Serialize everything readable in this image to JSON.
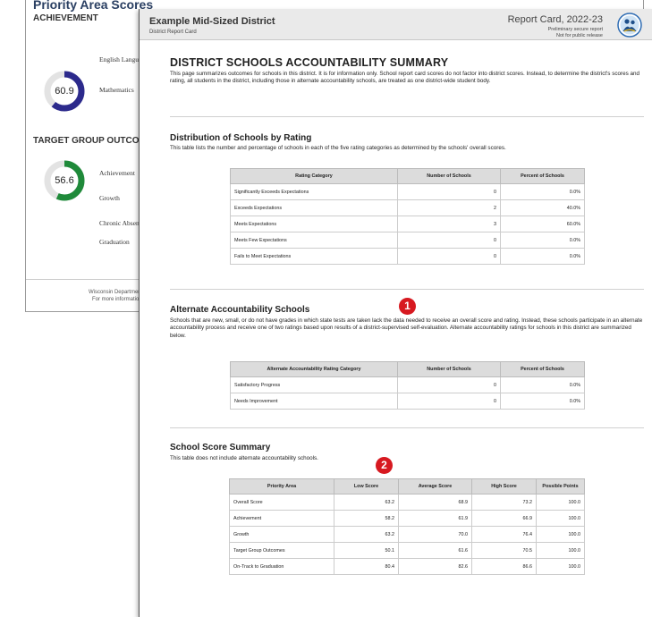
{
  "back": {
    "title": "Priority Area Scores",
    "achievement_heading": "ACHIEVEMENT",
    "achievement_value": "60.9",
    "achievement_items": [
      "English Language",
      "Mathematics"
    ],
    "target_heading": "TARGET GROUP OUTCOMES",
    "target_value": "56.6",
    "target_items": [
      "Achievement",
      "Growth",
      "Chronic Absenteeism",
      "Graduation"
    ],
    "footer_line1": "Wisconsin Department of Public",
    "footer_line2_prefix": "For more information, visit ",
    "footer_link": "http",
    "colors": {
      "achievement_ring": "#2c2a8c",
      "target_ring": "#1f8a3a",
      "ring_track": "#e3e3e3"
    }
  },
  "header": {
    "district": "Example Mid-Sized District",
    "district_sub": "District Report Card",
    "report_title": "Report Card, 2022-23",
    "prelim_line1": "Preliminary secure report",
    "prelim_line2": "Not for public release",
    "logo_icon": "wisconsin-dpi-logo-icon"
  },
  "summary": {
    "title": "DISTRICT SCHOOLS ACCOUNTABILITY SUMMARY",
    "text": "This page summarizes outcomes for schools in this district. It is for information only. School report card scores do not factor into district scores. Instead, to determine the district's scores and rating, all students in the district, including those in alternate accountability schools, are treated as one district-wide student body."
  },
  "distribution": {
    "title": "Distribution of Schools by Rating",
    "text": "This table lists the number and percentage of schools in each of the five rating categories as determined by the schools' overall scores.",
    "columns": [
      "Rating Category",
      "Number of Schools",
      "Percent of Schools"
    ],
    "rows": [
      [
        "Significantly Exceeds Expectations",
        "0",
        "0.0%"
      ],
      [
        "Exceeds Expectations",
        "2",
        "40.0%"
      ],
      [
        "Meets Expectations",
        "3",
        "60.0%"
      ],
      [
        "Meets Few Expectations",
        "0",
        "0.0%"
      ],
      [
        "Fails to Meet Expectations",
        "0",
        "0.0%"
      ]
    ]
  },
  "alternate": {
    "title": "Alternate Accountability Schools",
    "text": "Schools that are new, small, or do not have grades in which state tests are taken lack the data needed to receive an overall score and rating. Instead, these schools participate in an alternate accountability process and receive one of two ratings based upon results of a district-supervised self-evaluation. Alternate accountability ratings for schools in this district are summarized below.",
    "columns": [
      "Alternate Accountability Rating Category",
      "Number of Schools",
      "Percent of Schools"
    ],
    "rows": [
      [
        "Satisfactory Progress",
        "0",
        "0.0%"
      ],
      [
        "Needs Improvement",
        "0",
        "0.0%"
      ]
    ]
  },
  "score_summary": {
    "title": "School Score Summary",
    "text": "This table does not include alternate accountability schools.",
    "columns": [
      "Priority Area",
      "Low Score",
      "Average Score",
      "High Score",
      "Possible Points"
    ],
    "rows": [
      [
        "Overall Score",
        "63.2",
        "68.9",
        "73.2",
        "100.0"
      ],
      [
        "Achievement",
        "58.2",
        "61.9",
        "66.9",
        "100.0"
      ],
      [
        "Growth",
        "63.2",
        "70.0",
        "76.4",
        "100.0"
      ],
      [
        "Target Group Outcomes",
        "50.1",
        "61.6",
        "70.5",
        "100.0"
      ],
      [
        "On-Track to Graduation",
        "80.4",
        "82.6",
        "86.6",
        "100.0"
      ]
    ]
  },
  "markers": {
    "one": "1",
    "two": "2",
    "color": "#d71920"
  }
}
